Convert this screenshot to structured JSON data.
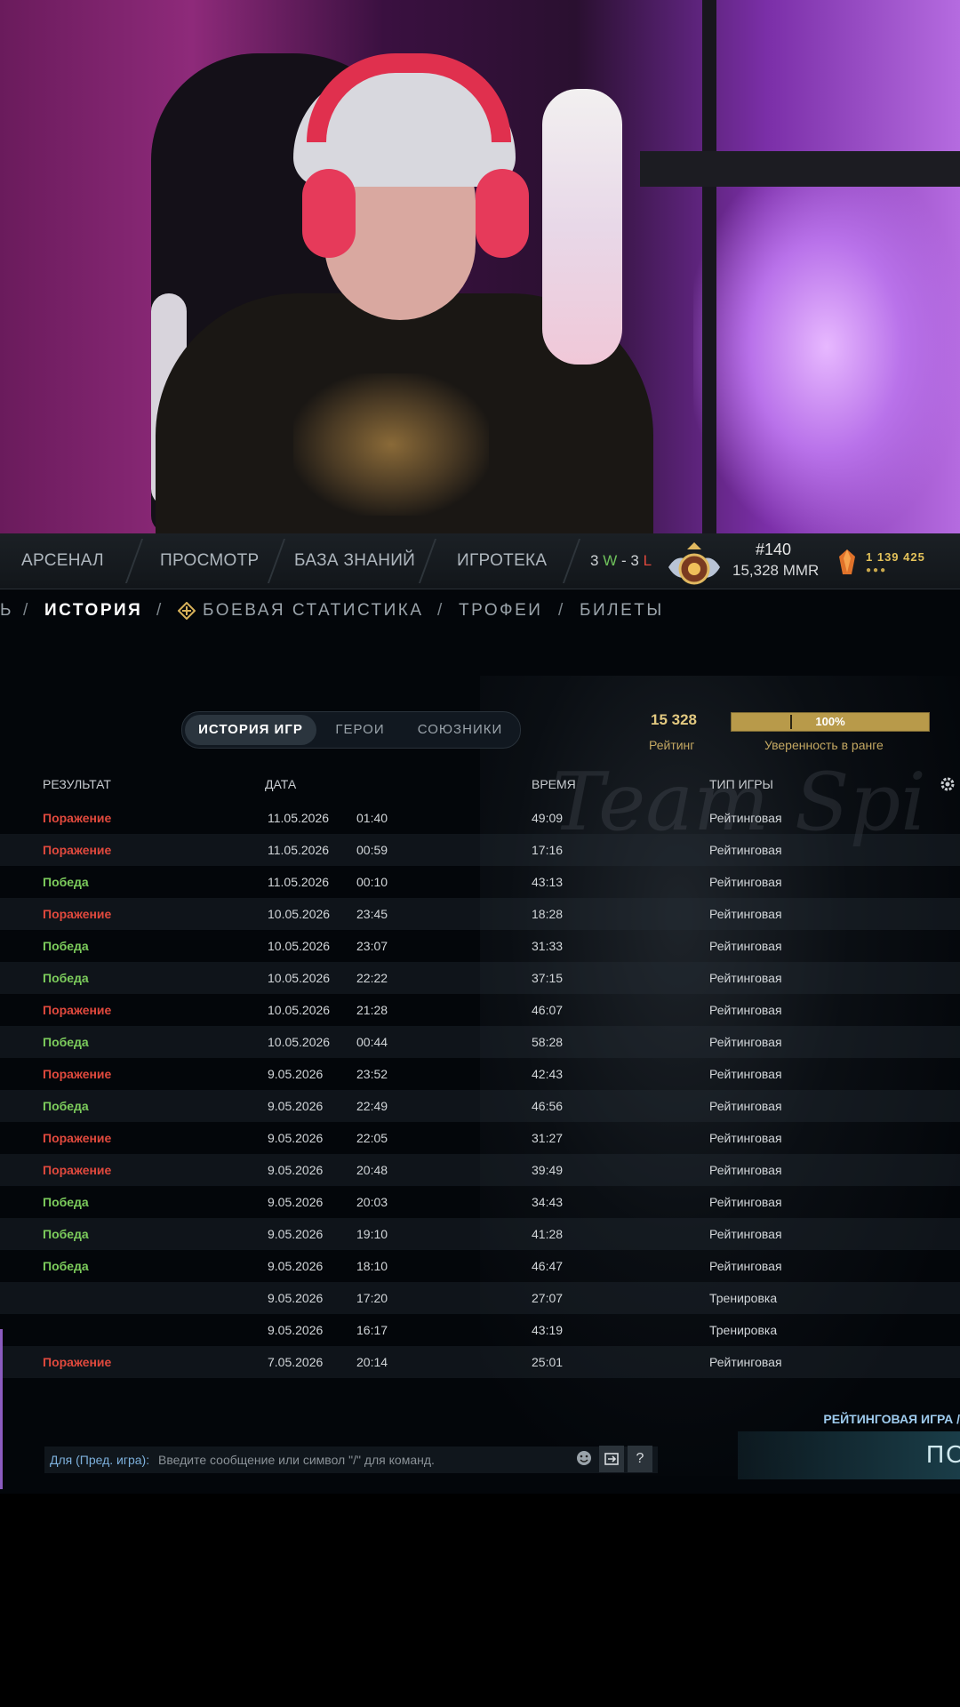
{
  "nav": {
    "items": [
      "АРСЕНАЛ",
      "ПРОСМОТР",
      "БАЗА ЗНАНИЙ",
      "ИГРОТЕКА"
    ],
    "record": {
      "wins": "3",
      "w_letter": "W",
      "dash": " - ",
      "losses": "3",
      "l_letter": "L"
    },
    "rank": "#140",
    "mmr": "15,328 MMR",
    "currency": "1  139  425",
    "currency_dots": "●●●"
  },
  "subnav": {
    "lead": "ь",
    "items": [
      "ИСТОРИЯ",
      "БОЕВАЯ СТАТИСТИКА",
      "ТРОФЕИ",
      "БИЛЕТЫ"
    ],
    "slash": "/"
  },
  "tabs": [
    "ИСТОРИЯ ИГР",
    "ГЕРОИ",
    "СОЮЗНИКИ"
  ],
  "rating": {
    "value": "15 328",
    "label": "Рейтинг"
  },
  "confidence": {
    "value_text": "100%",
    "fraction": 1.0,
    "label": "Уверенность в ранге"
  },
  "table": {
    "headers": [
      "РЕЗУЛЬТАТ",
      "ДАТА",
      "ВРЕМЯ",
      "ТИП ИГРЫ"
    ],
    "rows": [
      [
        "Поражение",
        "11.05.2026",
        "01:40",
        "49:09",
        "Рейтинговая"
      ],
      [
        "Поражение",
        "11.05.2026",
        "00:59",
        "17:16",
        "Рейтинговая"
      ],
      [
        "Победа",
        "11.05.2026",
        "00:10",
        "43:13",
        "Рейтинговая"
      ],
      [
        "Поражение",
        "10.05.2026",
        "23:45",
        "18:28",
        "Рейтинговая"
      ],
      [
        "Победа",
        "10.05.2026",
        "23:07",
        "31:33",
        "Рейтинговая"
      ],
      [
        "Победа",
        "10.05.2026",
        "22:22",
        "37:15",
        "Рейтинговая"
      ],
      [
        "Поражение",
        "10.05.2026",
        "21:28",
        "46:07",
        "Рейтинговая"
      ],
      [
        "Победа",
        "10.05.2026",
        "00:44",
        "58:28",
        "Рейтинговая"
      ],
      [
        "Поражение",
        "9.05.2026",
        "23:52",
        "42:43",
        "Рейтинговая"
      ],
      [
        "Победа",
        "9.05.2026",
        "22:49",
        "46:56",
        "Рейтинговая"
      ],
      [
        "Поражение",
        "9.05.2026",
        "22:05",
        "31:27",
        "Рейтинговая"
      ],
      [
        "Поражение",
        "9.05.2026",
        "20:48",
        "39:49",
        "Рейтинговая"
      ],
      [
        "Победа",
        "9.05.2026",
        "20:03",
        "34:43",
        "Рейтинговая"
      ],
      [
        "Победа",
        "9.05.2026",
        "19:10",
        "41:28",
        "Рейтинговая"
      ],
      [
        "Победа",
        "9.05.2026",
        "18:10",
        "46:47",
        "Рейтинговая"
      ],
      [
        "",
        "9.05.2026",
        "17:20",
        "27:07",
        "Тренировка"
      ],
      [
        "",
        "9.05.2026",
        "16:17",
        "43:19",
        "Тренировка"
      ],
      [
        "Поражение",
        "7.05.2026",
        "20:14",
        "25:01",
        "Рейтинговая"
      ]
    ]
  },
  "queue": {
    "label": "РЕЙТИНГОВАЯ ИГРА /",
    "play_label": "ПО"
  },
  "chat": {
    "who": "Для (Пред. игра):",
    "placeholder": "Введите сообщение или символ \"/\" для команд.",
    "help_label": "?"
  },
  "background_text": "Team Spi",
  "colors": {
    "loss": "#e0493d",
    "win": "#7ccc5c",
    "gold": "#b89a4a",
    "accent_blue": "#9ecbee"
  }
}
